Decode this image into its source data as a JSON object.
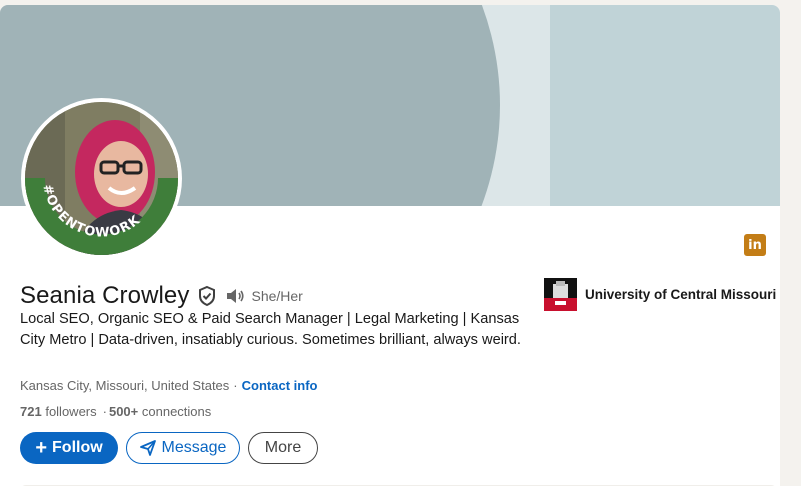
{
  "profile": {
    "name": "Seania Crowley",
    "pronouns": "She/Her",
    "headline": "Local SEO, Organic SEO & Paid Search Manager | Legal Marketing | Kansas City Metro | Data-driven, insatiably curious. Sometimes brilliant, always weird.",
    "location": "Kansas City, Missouri, United States",
    "separator": "·",
    "contact_label": "Contact info",
    "followers_count": "721",
    "followers_label": "followers",
    "connections_count": "500+",
    "connections_label": "connections",
    "open_to_work_badge": "#OPENTOWORK"
  },
  "education": {
    "school_name": "University of Central Missouri"
  },
  "actions": {
    "follow_label": "Follow",
    "follow_icon": "+",
    "message_label": "Message",
    "more_label": "More"
  },
  "brand": {
    "icon_text": "in",
    "icon_name": "linkedin-logo-icon"
  },
  "colors": {
    "primary_blue": "#0a66c2",
    "banner": "#a0b3b7",
    "open_to_work_green": "#3f7e3a",
    "brand_icon": "#c37d16"
  }
}
